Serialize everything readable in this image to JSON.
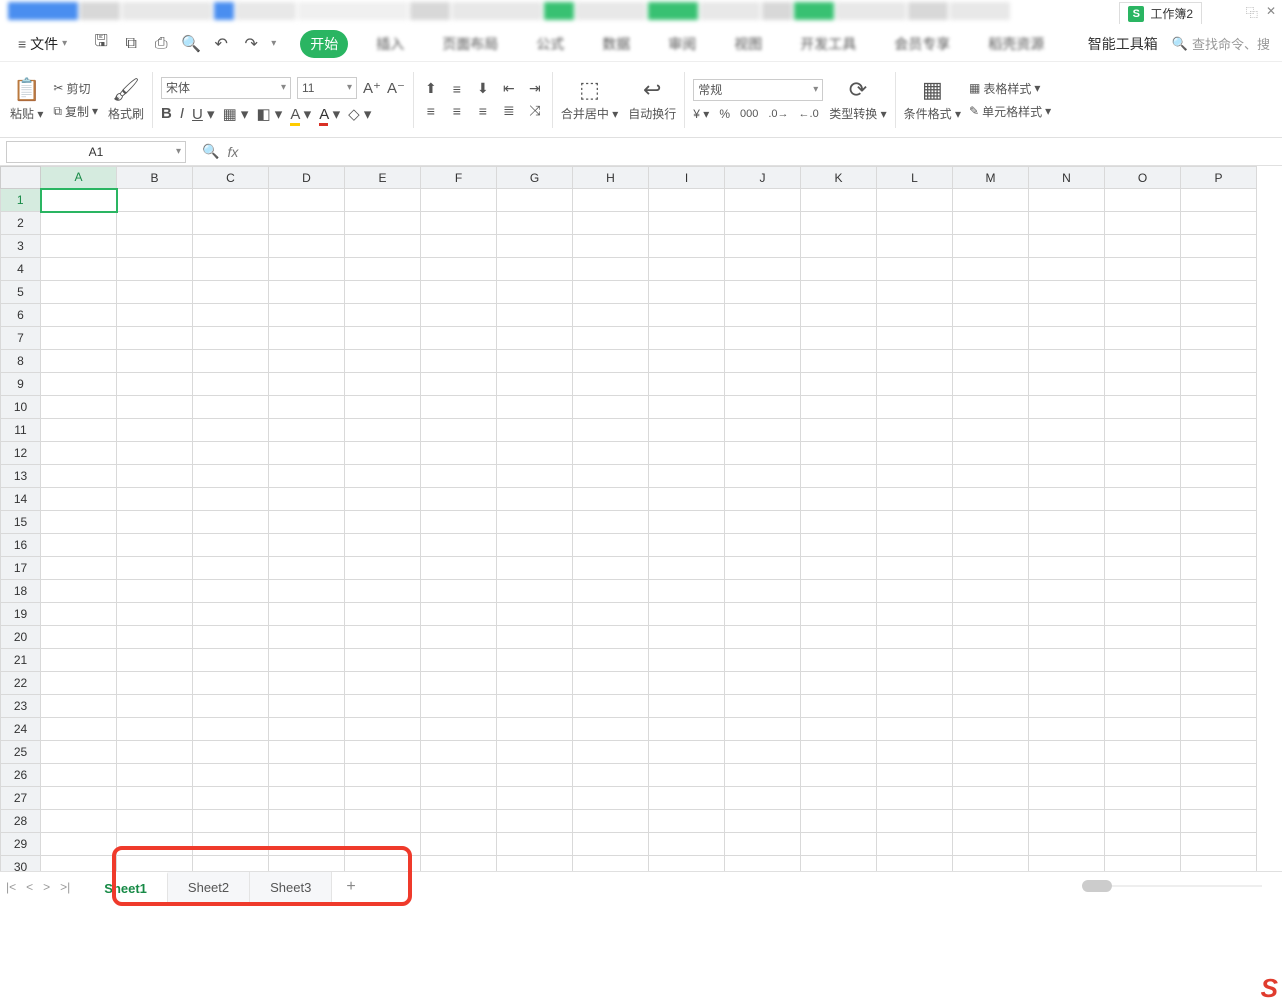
{
  "title": {
    "doc_name": "工作簿2"
  },
  "menubar": {
    "file": "文件",
    "tabs": [
      "开始",
      "插入",
      "页面布局",
      "公式",
      "数据",
      "审阅",
      "视图",
      "开发工具",
      "会员专享",
      "稻壳资源"
    ],
    "smart_toolbox": "智能工具箱",
    "search_placeholder": "查找命令、搜"
  },
  "ribbon": {
    "paste": "粘贴",
    "cut": "剪切",
    "copy": "复制",
    "format_painter": "格式刷",
    "font_name": "宋体",
    "font_size": "11",
    "merge": "合并居中",
    "wrap": "自动换行",
    "number_format": "常规",
    "type_convert": "类型转换",
    "cond_fmt": "条件格式",
    "table_style": "表格样式",
    "cell_style": "单元格样式"
  },
  "fx": {
    "name_box": "A1"
  },
  "grid": {
    "cols": [
      "A",
      "B",
      "C",
      "D",
      "E",
      "F",
      "G",
      "H",
      "I",
      "J",
      "K",
      "L",
      "M",
      "N",
      "O",
      "P"
    ],
    "rows": 30,
    "active": "A1"
  },
  "sheets": {
    "tabs": [
      "Sheet1",
      "Sheet2",
      "Sheet3"
    ],
    "active_index": 0
  }
}
